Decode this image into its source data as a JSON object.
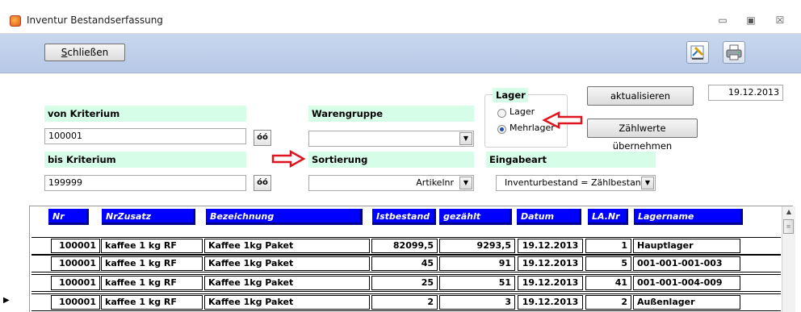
{
  "window": {
    "title": "Inventur Bestandserfassung",
    "minimize": "▭",
    "maximize": "▣",
    "close": "☒"
  },
  "toolbar": {
    "close_prefix": "",
    "close_underline": "S",
    "close_rest": "chließen",
    "icons": [
      "edit-report-icon",
      "printer-icon"
    ]
  },
  "filters": {
    "von_label": "von Kriterium",
    "von_value": "100001",
    "bis_label": "bis Kriterium",
    "bis_value": "199999",
    "warengruppe_label": "Warengruppe",
    "warengruppe_value": "",
    "sortierung_label": "Sortierung",
    "sortierung_value": "Artikelnr",
    "eingabeart_label": "Eingabeart",
    "eingabeart_value": "Inventurbestand = Zählbestand",
    "lager_label": "Lager",
    "lager_options": [
      "Lager",
      "Mehrlager"
    ],
    "lager_selected": "Mehrlager",
    "date": "19.12.2013",
    "refresh_button": "aktualisieren",
    "apply_button": "Zählwerte übernehmen",
    "binoc_glyph": "óó"
  },
  "grid": {
    "columns": [
      "Nr",
      "NrZusatz",
      "Bezeichnung",
      "Istbestand",
      "gezählt",
      "Datum",
      "LA.Nr",
      "Lagername"
    ],
    "rows": [
      {
        "nr": "100001",
        "zusatz": "kaffee 1 kg RF",
        "bez": "Kaffee 1kg Paket",
        "ist": "82099,5",
        "gez": "9293,5",
        "datum": "19.12.2013",
        "la": "1",
        "lager": "Hauptlager"
      },
      {
        "nr": "100001",
        "zusatz": "kaffee 1 kg RF",
        "bez": "Kaffee 1kg Paket",
        "ist": "45",
        "gez": "91",
        "datum": "19.12.2013",
        "la": "5",
        "lager": "001-001-001-003"
      },
      {
        "nr": "100001",
        "zusatz": "kaffee 1 kg RF",
        "bez": "Kaffee 1kg Paket",
        "ist": "25",
        "gez": "51",
        "datum": "19.12.2013",
        "la": "41",
        "lager": "001-001-004-009"
      },
      {
        "nr": "100001",
        "zusatz": "kaffee 1 kg RF",
        "bez": "Kaffee 1kg Paket",
        "ist": "2",
        "gez": "3",
        "datum": "19.12.2013",
        "la": "2",
        "lager": "Außenlager"
      }
    ],
    "current_row_marker": "▶"
  },
  "colors": {
    "label_bg": "#d5fde8",
    "header_bg": "#0000ff",
    "arrow": "#e0141e"
  }
}
